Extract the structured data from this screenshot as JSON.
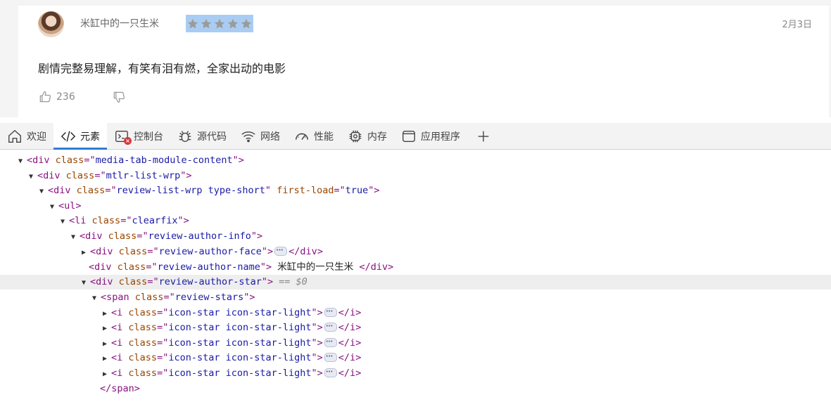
{
  "review": {
    "author_name": "米缸中的一只生米",
    "date": "2月3日",
    "text": "剧情完整易理解，有笑有泪有燃，全家出动的电影",
    "likes": "236",
    "stars": 5
  },
  "devtools": {
    "tabs": [
      {
        "label": "欢迎",
        "icon": "home-icon"
      },
      {
        "label": "元素",
        "icon": "code-icon"
      },
      {
        "label": "控制台",
        "icon": "console-icon"
      },
      {
        "label": "源代码",
        "icon": "bug-icon"
      },
      {
        "label": "网络",
        "icon": "wifi-icon"
      },
      {
        "label": "性能",
        "icon": "gauge-icon"
      },
      {
        "label": "内存",
        "icon": "chip-icon"
      },
      {
        "label": "应用程序",
        "icon": "window-icon"
      }
    ],
    "tree": {
      "r1": {
        "tag": "div",
        "attr": "class",
        "val": "media-tab-module-content"
      },
      "r2": {
        "tag": "div",
        "attr": "class",
        "val": "mtlr-list-wrp"
      },
      "r3": {
        "tag": "div",
        "attr": "class",
        "val": "review-list-wrp type-short",
        "attr2": "first-load",
        "val2": "true"
      },
      "r4": {
        "tag": "ul"
      },
      "r5": {
        "tag": "li",
        "attr": "class",
        "val": "clearfix"
      },
      "r6": {
        "tag": "div",
        "attr": "class",
        "val": "review-author-info"
      },
      "r7": {
        "tag": "div",
        "attr": "class",
        "val": "review-author-face",
        "close": "div"
      },
      "r8": {
        "tag": "div",
        "attr": "class",
        "val": "review-author-name",
        "text": "米缸中的一只生米",
        "close": "div"
      },
      "r9": {
        "tag": "div",
        "attr": "class",
        "val": "review-author-star",
        "eq": "== $0"
      },
      "r10": {
        "tag": "span",
        "attr": "class",
        "val": "review-stars"
      },
      "star_row": {
        "tag": "i",
        "attr": "class",
        "val": "icon-star icon-star-light",
        "close": "i"
      },
      "r16": {
        "close": "span"
      }
    }
  }
}
